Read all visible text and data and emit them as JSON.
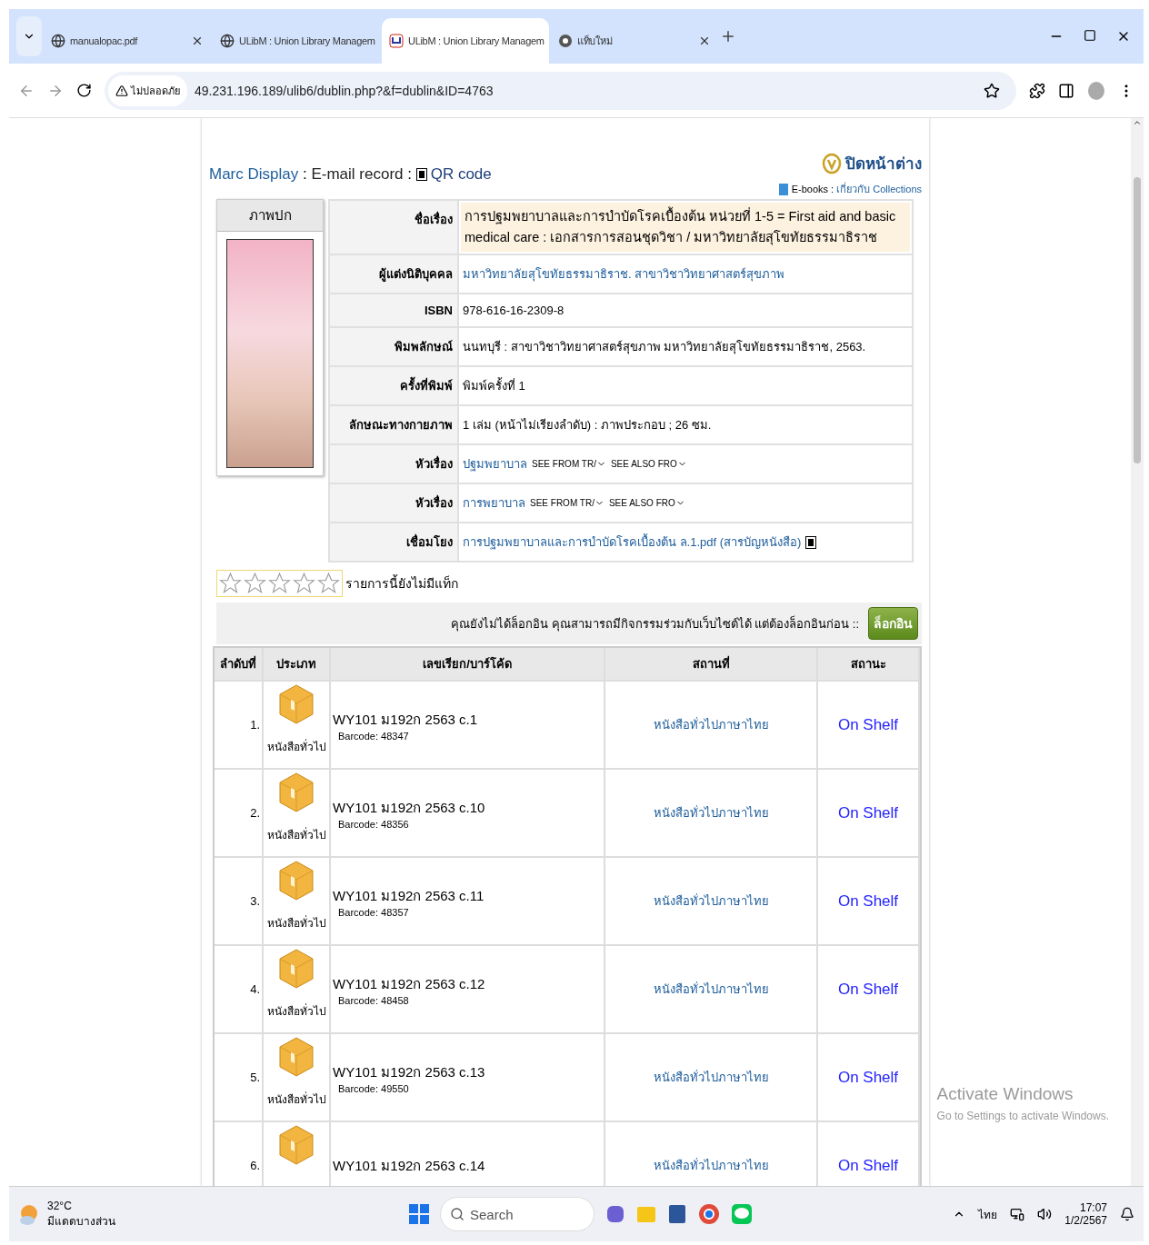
{
  "browser": {
    "tabs": [
      {
        "title": "manualopac.pdf",
        "kind": "page",
        "selected": false
      },
      {
        "title": "ULibM : Union Library Managem",
        "kind": "page",
        "selected": false
      },
      {
        "title": "ULibM : Union Library Managem",
        "kind": "site",
        "selected": true
      },
      {
        "title": "แท็บใหม่",
        "kind": "newtab",
        "selected": false
      }
    ],
    "security_label": "ไม่ปลอดภัย",
    "url": "49.231.196.189/ulib6/dublin.php?&f=dublin&ID=4763"
  },
  "header": {
    "links": [
      {
        "text": "Marc Display",
        "kind": "link"
      },
      {
        "text": " : ",
        "kind": "sep"
      },
      {
        "text": "E-mail record",
        "kind": "plain"
      },
      {
        "text": " : ",
        "kind": "sep"
      },
      {
        "text": "QR code",
        "kind": "qr"
      }
    ],
    "close_label": "ปิดหน้าต่าง",
    "ebooks_label": "E-books :",
    "ebooks_link": "เกี่ยวกับ Collections"
  },
  "cover": {
    "heading": "ภาพปก"
  },
  "record": [
    {
      "label": "ชื่อเรื่อง",
      "kind": "title",
      "value": "การปฐมพยาบาลและการบำบัดโรคเบื้องต้น หน่วยที่ 1-5 = First aid and basic medical care : เอกสารการสอนชุดวิชา / มหาวิทยาลัยสุโขทัยธรรมาธิราช"
    },
    {
      "label": "ผู้แต่งนิติบุคคล",
      "kind": "link",
      "value": "มหาวิทยาลัยสุโขทัยธรรมาธิราช. สาขาวิชาวิทยาศาสตร์สุขภาพ"
    },
    {
      "label": "ISBN",
      "kind": "text",
      "value": "978-616-16-2309-8"
    },
    {
      "label": "พิมพลักษณ์",
      "kind": "text",
      "value": "นนทบุรี : สาขาวิชาวิทยาศาสตร์สุขภาพ มหาวิทยาลัยสุโขทัยธรรมาธิราช, 2563."
    },
    {
      "label": "ครั้งที่พิมพ์",
      "kind": "text",
      "value": "พิมพ์ครั้งที่ 1"
    },
    {
      "label": "ลักษณะทางกายภาพ",
      "kind": "text",
      "value": "1 เล่ม (หน้าไม่เรียงลำดับ) : ภาพประกอบ ; 26 ซม."
    },
    {
      "label": "หัวเรื่อง",
      "kind": "subject",
      "value": "ปฐมพยาบาล",
      "see_from": "SEE FROM TR/",
      "see_also": "SEE ALSO FRO"
    },
    {
      "label": "หัวเรื่อง",
      "kind": "subject",
      "value": "การพยาบาล",
      "see_from": "SEE FROM TR/",
      "see_also": "SEE ALSO FRO"
    },
    {
      "label": "เชื่อมโยง",
      "kind": "file",
      "value": "การปฐมพยาบาลและการบำบัดโรคเบื้องต้น ล.1.pdf (สารบัญหนังสือ)"
    }
  ],
  "rating": {
    "stars": 0,
    "tag_note": "รายการนี้ยังไม่มีแท็ก"
  },
  "login_bar": {
    "message": "คุณยังไม่ได้ล็อกอิน คุณสามารถมีกิจกรรมร่วมกับเว็บไซต์ได้ แต่ต้องล็อกอินก่อน ::",
    "button": "ล็อกอิน"
  },
  "items": {
    "columns": [
      "ลำดับที่",
      "ประเภท",
      "เลขเรียก/บาร์โค้ด",
      "สถานที่",
      "สถานะ"
    ],
    "rows": [
      {
        "no": "1.",
        "type": "หนังสือทั่วไป",
        "call_no": "WY101 ม192ก 2563 c.1",
        "barcode": "Barcode: 48347",
        "location": "หนังสือทั่วไปภาษาไทย",
        "status": "On Shelf"
      },
      {
        "no": "2.",
        "type": "หนังสือทั่วไป",
        "call_no": "WY101 ม192ก 2563 c.10",
        "barcode": "Barcode: 48356",
        "location": "หนังสือทั่วไปภาษาไทย",
        "status": "On Shelf"
      },
      {
        "no": "3.",
        "type": "หนังสือทั่วไป",
        "call_no": "WY101 ม192ก 2563 c.11",
        "barcode": "Barcode: 48357",
        "location": "หนังสือทั่วไปภาษาไทย",
        "status": "On Shelf"
      },
      {
        "no": "4.",
        "type": "หนังสือทั่วไป",
        "call_no": "WY101 ม192ก 2563 c.12",
        "barcode": "Barcode: 48458",
        "location": "หนังสือทั่วไปภาษาไทย",
        "status": "On Shelf"
      },
      {
        "no": "5.",
        "type": "หนังสือทั่วไป",
        "call_no": "WY101 ม192ก 2563 c.13",
        "barcode": "Barcode: 49550",
        "location": "หนังสือทั่วไปภาษาไทย",
        "status": "On Shelf"
      },
      {
        "no": "6.",
        "call_no": "WY101 ม192ก 2563 c.14",
        "location": "หนังสือทั่วไปภาษาไทย",
        "status": "On Shelf"
      }
    ]
  },
  "activation": {
    "title": "Activate Windows",
    "hint": "Go to Settings to activate Windows."
  },
  "taskbar": {
    "weather_temp": "32°C",
    "weather_text": "มีแดดบางส่วน",
    "search": "Search",
    "language": "ไทย",
    "time": "17:07",
    "date": "1/2/2567"
  }
}
